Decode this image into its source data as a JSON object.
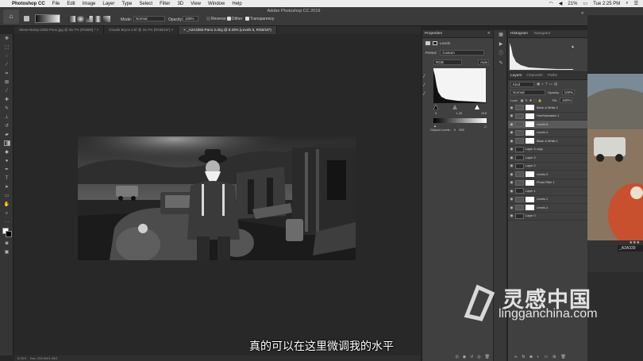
{
  "menubar": {
    "app": "Photoshop CC",
    "items": [
      "File",
      "Edit",
      "Image",
      "Layer",
      "Type",
      "Select",
      "Filter",
      "3D",
      "View",
      "Window",
      "Help"
    ],
    "battery": "21%",
    "clock": "Tue 2:25 PM"
  },
  "app_title": "Adobe Photoshop CC 2019",
  "options": {
    "mode_label": "Mode:",
    "mode_value": "Normal",
    "opacity_label": "Opacity:",
    "opacity_value": "100%",
    "reverse": "Reverse",
    "dither": "Dither",
    "transparency": "Transparency"
  },
  "tabs": [
    {
      "label": "Steve-Namp-3392-Pano.jpg @ 66.7% (RGB/8) *"
    },
    {
      "label": "Clouds Bryce 2.tif @ 16.7% (RGB/16*)"
    },
    {
      "label": "_A2A3392-Pano 2.dng @ 8.33% (Levels 5, RGB/16*)"
    }
  ],
  "properties": {
    "title": "Properties",
    "adj_name": "Levels",
    "preset_label": "Preset:",
    "preset_value": "Custom",
    "channel": "RGB",
    "auto": "Auto",
    "input_low": "0",
    "input_mid": "1.20",
    "input_high": "215",
    "output_label": "Output Levels:",
    "output_low": "0",
    "output_high": "255"
  },
  "histogram_panel": {
    "tab1": "Histogram",
    "tab2": "Navigator"
  },
  "layers_panel": {
    "tabs": [
      "Layers",
      "Channels",
      "Paths"
    ],
    "kind": "Kind",
    "blend": "Normal",
    "opacity_label": "Opacity:",
    "opacity_value": "100%",
    "lock_label": "Lock:",
    "fill_label": "Fill:",
    "fill_value": "100%",
    "layers": [
      {
        "name": "Black & White 2",
        "type": "adj",
        "selected": false
      },
      {
        "name": "Hue/Saturation 1",
        "type": "adj",
        "selected": false
      },
      {
        "name": "Levels 5",
        "type": "adj",
        "selected": true
      },
      {
        "name": "Levels 4",
        "type": "adj",
        "selected": false
      },
      {
        "name": "Black & White 1",
        "type": "adj",
        "selected": false
      },
      {
        "name": "Layer 3 copy",
        "type": "pix",
        "selected": false
      },
      {
        "name": "Layer 3",
        "type": "pix",
        "selected": false
      },
      {
        "name": "Layer 2",
        "type": "pix",
        "selected": false
      },
      {
        "name": "Levels 3",
        "type": "adj",
        "selected": false
      },
      {
        "name": "Photo Filter 1",
        "type": "adj",
        "selected": false
      },
      {
        "name": "Layer 1",
        "type": "pix",
        "selected": false
      },
      {
        "name": "Levels 1",
        "type": "adj",
        "selected": false
      },
      {
        "name": "Levels 2",
        "type": "adj",
        "selected": false
      },
      {
        "name": "Layer 0",
        "type": "pix",
        "selected": false
      }
    ]
  },
  "status": {
    "zoom": "8.33%",
    "doc": "Doc: 253.9M/1.06G"
  },
  "right_image": {
    "stars": "★★★",
    "caption": "_A2A339"
  },
  "subtitle": "真的可以在这里微调我的水平",
  "watermark": {
    "cn": "灵感中国",
    "en": "lingganchina.com"
  }
}
